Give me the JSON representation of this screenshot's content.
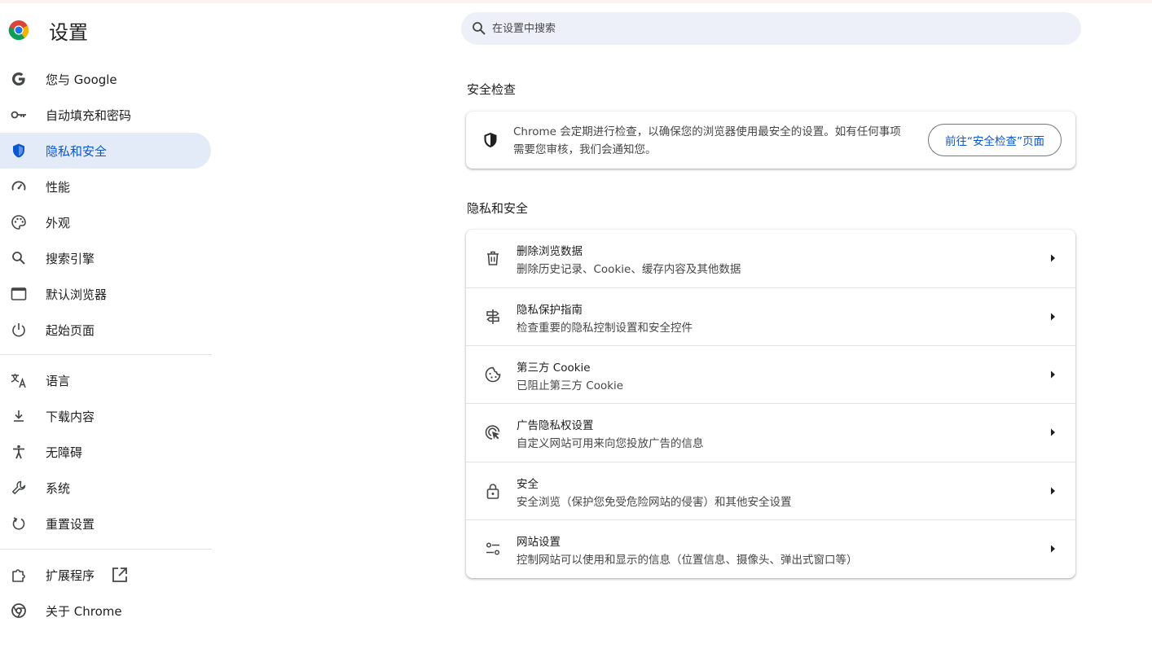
{
  "header": {
    "title": "设置"
  },
  "search": {
    "placeholder": "在设置中搜索"
  },
  "sidebar": {
    "items": [
      {
        "label": "您与 Google",
        "icon": "google-g-icon"
      },
      {
        "label": "自动填充和密码",
        "icon": "key-icon"
      },
      {
        "label": "隐私和安全",
        "icon": "shield-icon",
        "active": true
      },
      {
        "label": "性能",
        "icon": "speedometer-icon"
      },
      {
        "label": "外观",
        "icon": "palette-icon"
      },
      {
        "label": "搜索引擎",
        "icon": "search-icon"
      },
      {
        "label": "默认浏览器",
        "icon": "browser-window-icon"
      },
      {
        "label": "起始页面",
        "icon": "power-icon"
      },
      {
        "label": "语言",
        "icon": "translate-icon"
      },
      {
        "label": "下载内容",
        "icon": "download-icon"
      },
      {
        "label": "无障碍",
        "icon": "accessibility-icon"
      },
      {
        "label": "系统",
        "icon": "wrench-icon"
      },
      {
        "label": "重置设置",
        "icon": "reset-icon"
      },
      {
        "label": "扩展程序",
        "icon": "puzzle-icon"
      },
      {
        "label": "关于 Chrome",
        "icon": "chrome-icon"
      }
    ]
  },
  "safety_check": {
    "title": "安全检查",
    "description": "Chrome 会定期进行检查，以确保您的浏览器使用最安全的设置。如有任何事项需要您审核，我们会通知您。",
    "button_label": "前往“安全检查”页面"
  },
  "privacy": {
    "title": "隐私和安全",
    "rows": [
      {
        "title": "删除浏览数据",
        "subtitle": "删除历史记录、Cookie、缓存内容及其他数据",
        "icon": "trash-icon"
      },
      {
        "title": "隐私保护指南",
        "subtitle": "检查重要的隐私控制设置和安全控件",
        "icon": "guide-icon"
      },
      {
        "title": "第三方 Cookie",
        "subtitle": "已阻止第三方 Cookie",
        "icon": "cookie-icon"
      },
      {
        "title": "广告隐私权设置",
        "subtitle": "自定义网站可用来向您投放广告的信息",
        "icon": "ad-privacy-icon"
      },
      {
        "title": "安全",
        "subtitle": "安全浏览（保护您免受危险网站的侵害）和其他安全设置",
        "icon": "lock-icon"
      },
      {
        "title": "网站设置",
        "subtitle": "控制网站可以使用和显示的信息（位置信息、摄像头、弹出式窗口等）",
        "icon": "sliders-icon"
      }
    ]
  },
  "colors": {
    "accent": "#0b57d0",
    "active_bg": "#e3ebf8",
    "search_bg": "#edf0f8"
  }
}
